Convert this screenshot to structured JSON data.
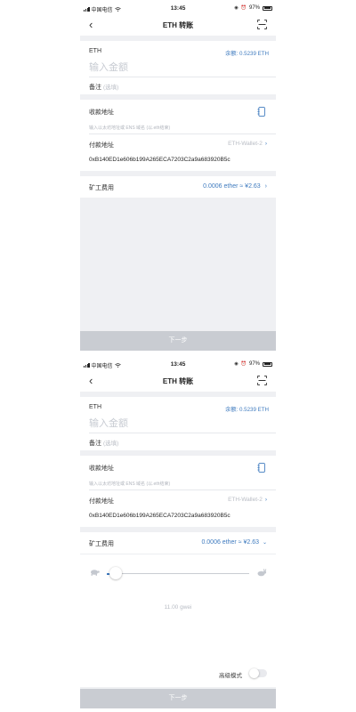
{
  "status_bar": {
    "carrier": "中国电信",
    "time": "13:45",
    "battery": "97%"
  },
  "nav": {
    "title": "ETH 转账"
  },
  "amount": {
    "asset": "ETH",
    "balance": "余额: 0.5239 ETH",
    "placeholder": "输入金额",
    "note_label": "备注",
    "note_placeholder": "(选填)"
  },
  "recipient": {
    "label": "收款地址",
    "placeholder": "输入以太坊地址或 ENS 域名 (以.eth结束)"
  },
  "payer": {
    "label": "付款地址",
    "wallet": "ETH-Wallet-2",
    "address": "0xB140ED1e606b199A265ECA7203C2a9a683920B5c"
  },
  "fee": {
    "label": "矿工费用",
    "value": "0.0006 ether ≈ ¥2.63",
    "gwei": "11.00 gwei",
    "slider_fraction": 0.06
  },
  "advanced": {
    "label": "高级模式",
    "enabled": false
  },
  "next_button": {
    "label": "下一步"
  },
  "colors": {
    "accent": "#3f7bbf",
    "disabled_button": "#c9ccd2",
    "background": "#eff0f3"
  },
  "icons": [
    "back-chevron-icon",
    "scan-icon",
    "address-book-icon",
    "chevron-right-icon",
    "chevron-down-icon",
    "turtle-icon",
    "rabbit-icon"
  ]
}
